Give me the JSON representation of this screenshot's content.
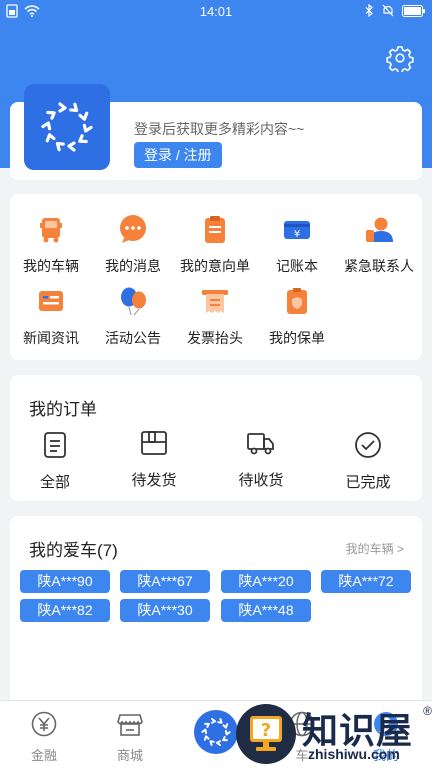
{
  "status_bar": {
    "time": "14:01"
  },
  "profile": {
    "login_tip": "登录后获取更多精彩内容~~",
    "login_button": "登录 / 注册"
  },
  "menu": [
    {
      "label": "我的车辆",
      "icon": "truck-icon"
    },
    {
      "label": "我的消息",
      "icon": "message-icon"
    },
    {
      "label": "我的意向单",
      "icon": "clipboard-icon"
    },
    {
      "label": "记账本",
      "icon": "wallet-icon"
    },
    {
      "label": "紧急联系人",
      "icon": "contact-person-icon"
    },
    {
      "label": "新闻资讯",
      "icon": "news-icon"
    },
    {
      "label": "活动公告",
      "icon": "balloon-icon"
    },
    {
      "label": "发票抬头",
      "icon": "invoice-icon"
    },
    {
      "label": "我的保单",
      "icon": "policy-icon"
    }
  ],
  "orders": {
    "title": "我的订单",
    "items": [
      {
        "label": "全部",
        "icon": "list-icon"
      },
      {
        "label": "待发货",
        "icon": "package-icon"
      },
      {
        "label": "待收货",
        "icon": "delivery-truck-icon"
      },
      {
        "label": "已完成",
        "icon": "check-circle-icon"
      }
    ]
  },
  "cars": {
    "title": "我的爱车(7)",
    "link": "我的车辆 >",
    "plates": [
      "陕A***90",
      "陕A***67",
      "陕A***20",
      "陕A***72",
      "陕A***82",
      "陕A***30",
      "陕A***48"
    ]
  },
  "tabs": [
    {
      "label": "金融",
      "icon": "yen-circle-icon"
    },
    {
      "label": "商城",
      "icon": "store-icon"
    },
    {
      "label": "车",
      "icon": "globe-icon"
    },
    {
      "label": "我的",
      "icon": "user-icon"
    }
  ],
  "watermark": {
    "text": "知识屋",
    "domain": "zhishiwu.com",
    "reg": "®"
  },
  "colors": {
    "primary": "#3d86f0",
    "logo": "#2f6fe4",
    "accent_orange": "#f5813a"
  }
}
